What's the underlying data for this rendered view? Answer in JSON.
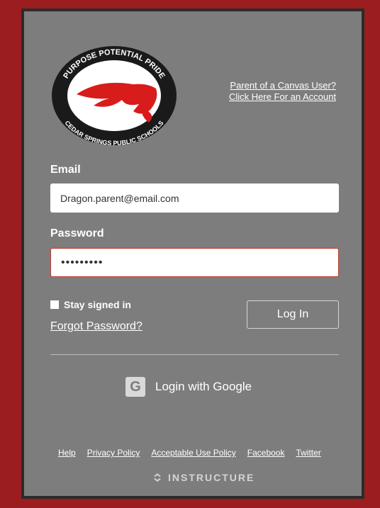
{
  "logo": {
    "top_text": "PURPOSE  POTENTIAL  PRIDE",
    "bottom_text": "CEDAR SPRINGS PUBLIC SCHOOLS",
    "colors": {
      "ring": "#1a1a1a",
      "inner": "#ffffff",
      "dragon": "#d81c1c"
    }
  },
  "parent_link": {
    "line1": "Parent of a Canvas User?",
    "line2": "Click Here For an Account"
  },
  "form": {
    "email_label": "Email",
    "email_value": "Dragon.parent@email.com",
    "password_label": "Password",
    "password_value": "•••••••••",
    "stay_signed_in": "Stay signed in",
    "forgot_password": "Forgot Password?",
    "login_button": "Log In"
  },
  "google": {
    "label": "Login with Google",
    "icon": "G"
  },
  "footer": {
    "links": [
      "Help",
      "Privacy Policy",
      "Acceptable Use Policy",
      "Facebook",
      "Twitter"
    ],
    "brand": "INSTRUCTURE"
  },
  "colors": {
    "background": "#9b1d20",
    "panel": "#7d7d7d",
    "panel_border": "#2b2b2b"
  }
}
